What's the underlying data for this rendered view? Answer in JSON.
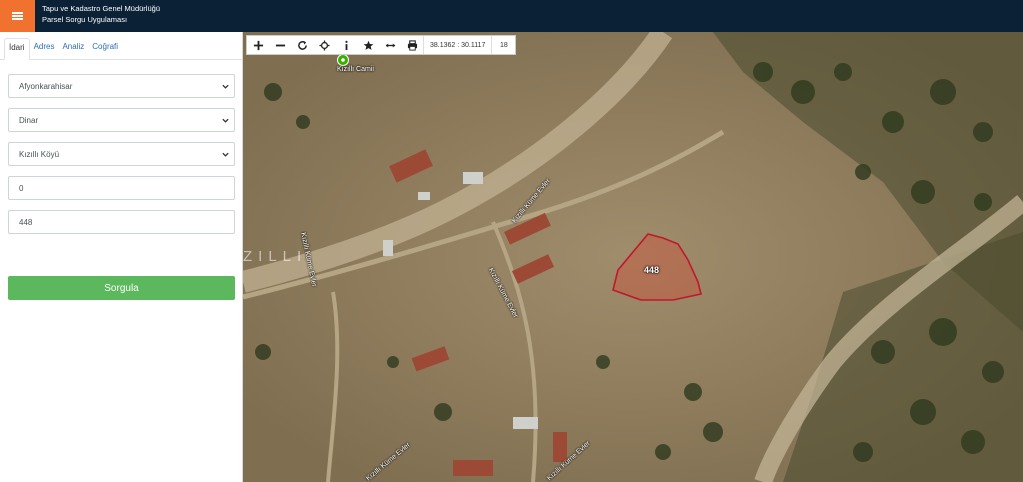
{
  "header": {
    "menu_icon": "hamburger-icon",
    "title_line1": "Tapu ve Kadastro Genel Müdürlüğü",
    "title_line2": "Parsel Sorgu Uygulaması",
    "accent_color": "#f0722e",
    "bar_color": "#0b2136"
  },
  "sidebar": {
    "tabs": [
      {
        "label": "İdari",
        "active": true
      },
      {
        "label": "Adres",
        "active": false
      },
      {
        "label": "Analiz",
        "active": false
      },
      {
        "label": "Coğrafi",
        "active": false
      }
    ],
    "province_select": "Afyonkarahisar",
    "district_select": "Dinar",
    "neighborhood_select": "Kızıllı Köyü",
    "block_input": "0",
    "parcel_input": "448",
    "query_button": "Sorgula",
    "button_color": "#5cb85c"
  },
  "map": {
    "toolbar": {
      "tools": [
        "zoom-in-icon",
        "zoom-out-icon",
        "refresh-icon",
        "locate-icon",
        "info-icon",
        "star-icon",
        "measure-icon",
        "print-icon"
      ],
      "coordinates": "38.1362 : 30.1117",
      "zoom_level": "18"
    },
    "poi_label": "Kızıllı Camii",
    "village_label": "ZILLI",
    "road_labels": [
      "Kızıllı Küme Evler",
      "Kızıllı Küme Evler",
      "Kızıllı Küme Evler",
      "Kızıllı Küme Evler",
      "Kızıllı Küme Evler"
    ],
    "parcel_number": "448",
    "parcel_color": "#c0182b"
  }
}
